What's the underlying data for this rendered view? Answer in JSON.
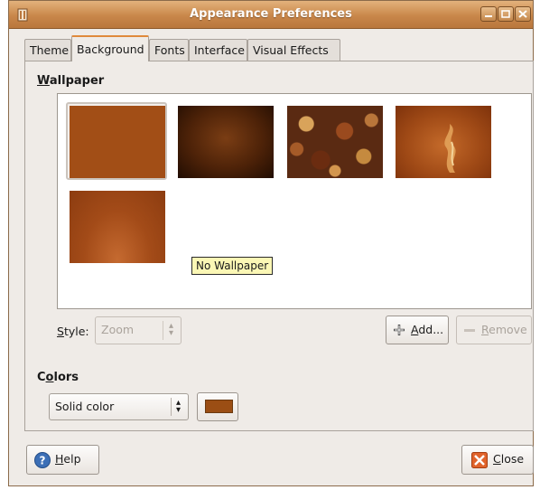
{
  "window": {
    "title": "Appearance Preferences",
    "controls": [
      "minimize-icon",
      "maximize-icon",
      "close-icon"
    ]
  },
  "tabs": [
    {
      "label": "Theme",
      "active": false
    },
    {
      "label": "Background",
      "active": true
    },
    {
      "label": "Fonts",
      "active": false
    },
    {
      "label": "Interface",
      "active": false
    },
    {
      "label": "Visual Effects",
      "active": false
    }
  ],
  "wallpaper": {
    "heading_mnemonic": "W",
    "heading_rest": "allpaper",
    "items": [
      {
        "name": "No Wallpaper",
        "color": "#a24e16",
        "selected": true
      },
      {
        "name": "",
        "color": "#4d2208"
      },
      {
        "name": "",
        "color": "#5a2a12"
      },
      {
        "name": "",
        "color": "#a04a16"
      },
      {
        "name": "",
        "color": "#a34b18"
      }
    ],
    "tooltip": "No Wallpaper",
    "style_label_mnemonic": "S",
    "style_label_rest": "tyle:",
    "style_value": "Zoom",
    "add_mnemonic": "A",
    "add_rest": "dd...",
    "remove_mnemonic": "R",
    "remove_rest": "emove"
  },
  "colors": {
    "heading_pre": "C",
    "heading_mnemonic": "o",
    "heading_rest": "lors",
    "mode_value": "Solid color",
    "swatch_color": "#9b4e14"
  },
  "footer": {
    "help_mnemonic": "H",
    "help_rest": "elp",
    "close_mnemonic": "C",
    "close_rest": "lose"
  }
}
